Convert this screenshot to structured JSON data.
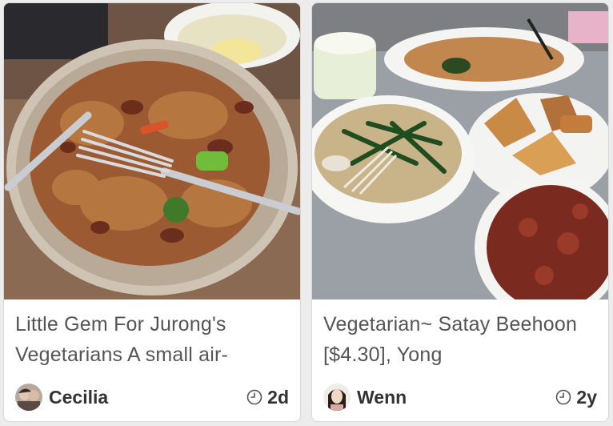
{
  "cards": [
    {
      "title": "Little Gem For Jurong's Vegetarians A small air-",
      "author": "Cecilia",
      "age": "2d",
      "author_icon": "avatar-photo",
      "time_icon": "clock-icon"
    },
    {
      "title": "Vegetarian~ Satay Beehoon [$4.30], Yong",
      "author": "Wenn",
      "age": "2y",
      "author_icon": "avatar-photo",
      "time_icon": "clock-icon"
    }
  ],
  "colors": {
    "page_bg": "#ececec",
    "card_bg": "#ffffff",
    "title_text": "#555555",
    "meta_text": "#333333"
  }
}
